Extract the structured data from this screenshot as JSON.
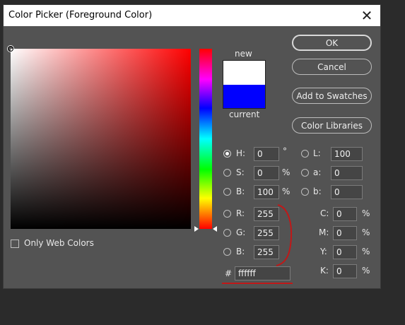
{
  "dialog": {
    "title": "Color Picker (Foreground Color)",
    "close_glyph": "✕",
    "close_icon": "close-icon"
  },
  "color": {
    "new_label": "new",
    "current_label": "current",
    "new_color": "#ffffff",
    "current_color": "#0000ff"
  },
  "buttons": {
    "ok": "OK",
    "cancel": "Cancel",
    "add_to_swatches": "Add to Swatches",
    "color_libraries": "Color Libraries"
  },
  "hsb": {
    "h": {
      "label": "H:",
      "value": "0",
      "unit": "°",
      "selected": true
    },
    "s": {
      "label": "S:",
      "value": "0",
      "unit": "%"
    },
    "b": {
      "label": "B:",
      "value": "100",
      "unit": "%"
    }
  },
  "lab": {
    "l": {
      "label": "L:",
      "value": "100"
    },
    "a": {
      "label": "a:",
      "value": "0"
    },
    "b": {
      "label": "b:",
      "value": "0"
    }
  },
  "rgb": {
    "r": {
      "label": "R:",
      "value": "255"
    },
    "g": {
      "label": "G:",
      "value": "255"
    },
    "b": {
      "label": "B:",
      "value": "255"
    }
  },
  "cmyk": {
    "c": {
      "label": "C:",
      "value": "0",
      "unit": "%"
    },
    "m": {
      "label": "M:",
      "value": "0",
      "unit": "%"
    },
    "y": {
      "label": "Y:",
      "value": "0",
      "unit": "%"
    },
    "k": {
      "label": "K:",
      "value": "0",
      "unit": "%"
    }
  },
  "hex": {
    "label": "#",
    "value": "ffffff"
  },
  "web_colors": {
    "label": "Only Web Colors",
    "checked": false
  },
  "annotation_color": "#c01818"
}
